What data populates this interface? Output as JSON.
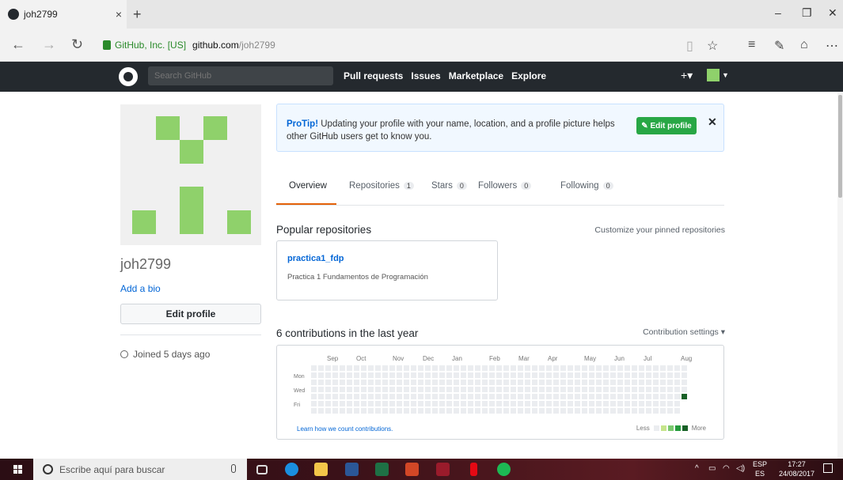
{
  "browser": {
    "tab_title": "joh2799",
    "tab_close": "×",
    "new_tab": "+",
    "address": {
      "owner": "GitHub, Inc. [US]",
      "host": "github.com",
      "path": "/joh2799"
    }
  },
  "header": {
    "search_placeholder": "Search GitHub",
    "nav": [
      "Pull requests",
      "Issues",
      "Marketplace",
      "Explore"
    ],
    "plus": "+▾"
  },
  "profile": {
    "username": "joh2799",
    "add_bio": "Add a bio",
    "edit_profile": "Edit profile",
    "joined": "Joined 5 days ago"
  },
  "protip": {
    "lead": "ProTip!",
    "text": " Updating your profile with your name, location, and a profile picture helps other GitHub users get to know you.",
    "edit_button": "✎ Edit profile",
    "close": "✕"
  },
  "tabs": [
    {
      "label": "Overview",
      "count": null
    },
    {
      "label": "Repositories",
      "count": "1"
    },
    {
      "label": "Stars",
      "count": "0"
    },
    {
      "label": "Followers",
      "count": "0"
    },
    {
      "label": "Following",
      "count": "0"
    }
  ],
  "popular": {
    "title": "Popular repositories",
    "customize": "Customize your pinned repositories",
    "repo_name": "practica1_fdp",
    "repo_desc": "Practica 1 Fundamentos de Programación"
  },
  "contributions": {
    "title": "6 contributions in the last year",
    "settings": "Contribution settings ▾",
    "months": [
      "Sep",
      "Oct",
      "Nov",
      "Dec",
      "Jan",
      "Feb",
      "Mar",
      "Apr",
      "May",
      "Jun",
      "Jul",
      "Aug"
    ],
    "days": [
      "Mon",
      "Wed",
      "Fri"
    ],
    "learn": "Learn how we count contributions.",
    "less": "Less",
    "more": "More",
    "colors": [
      "#ebedf0",
      "#c6e48b",
      "#7bc96f",
      "#239a3b",
      "#196127"
    ]
  },
  "taskbar": {
    "search": "Escribe aquí para buscar",
    "lang_top": "ESP",
    "lang_bottom": "ES",
    "time": "17:27",
    "date": "24/08/2017"
  }
}
